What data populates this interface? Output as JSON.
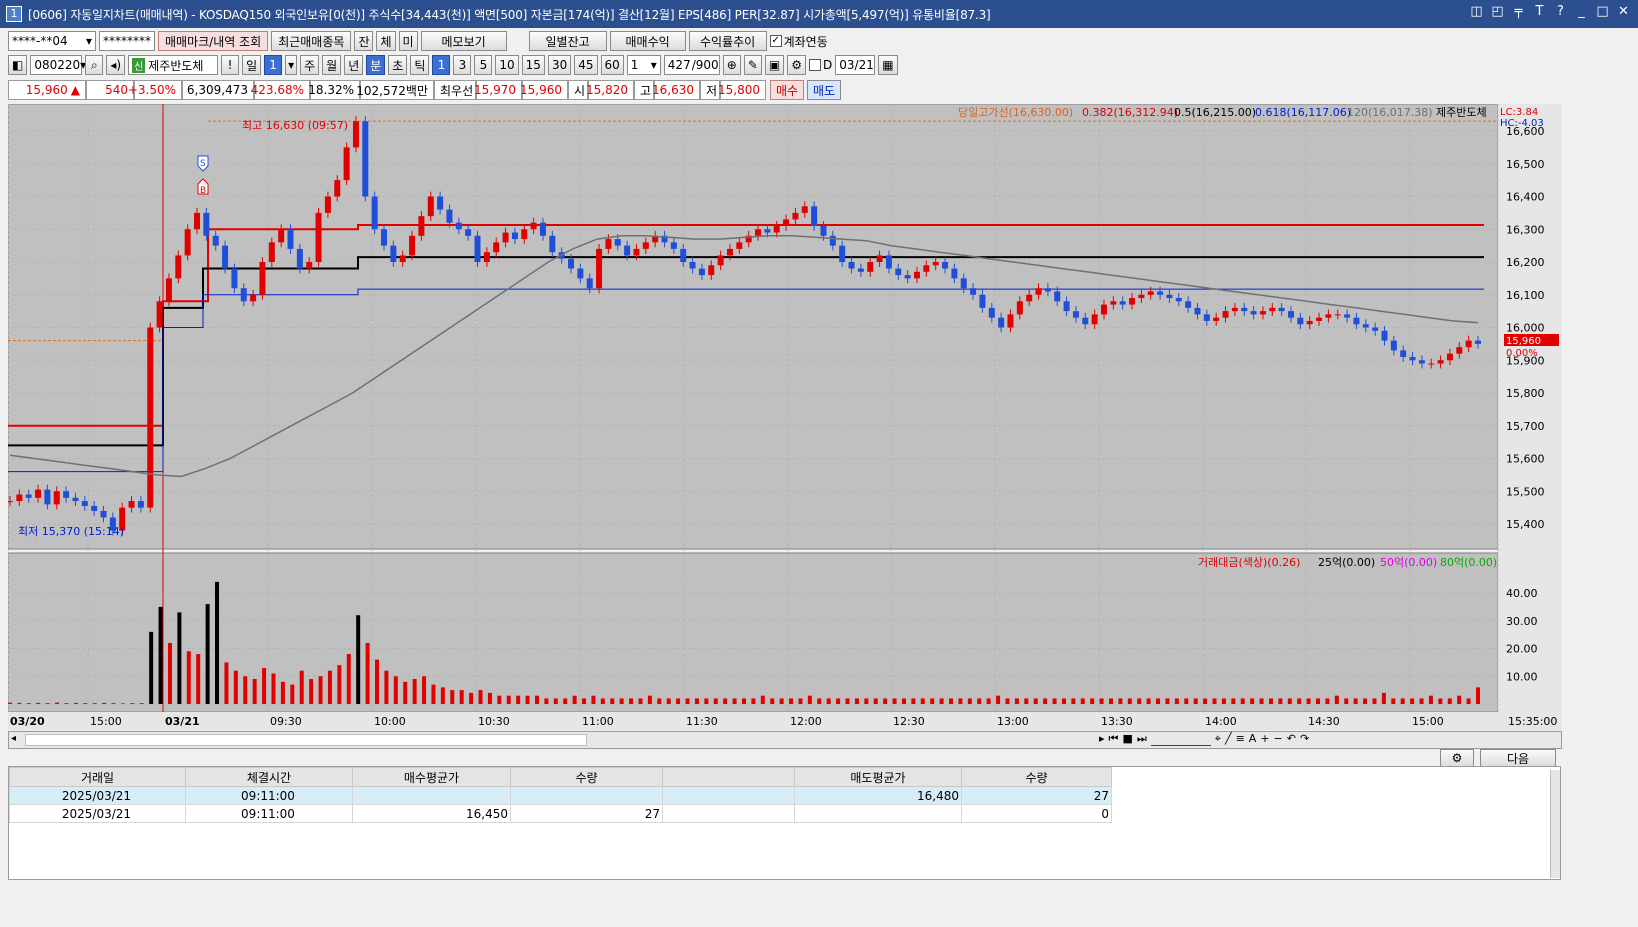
{
  "window": {
    "title": "[0606] 자동일지차트(매매내역) - KOSDAQ150 외국인보유[0(천)] 주식수[34,443(천)] 액면[500] 자본금[174(억)] 결산[12월] EPS[486] PER[32.87] 시가총액[5,497(억)] 유통비율[87.3]",
    "icon": "1",
    "controls": [
      "◫",
      "◰",
      "╤",
      "T",
      "?",
      "_",
      "□",
      "✕"
    ]
  },
  "toolbar1": {
    "account": "****-**04",
    "password": "********",
    "buttons": [
      "매매마크/내역 조회",
      "최근매매종목",
      "잔",
      "체",
      "미",
      "메모보기",
      "일별잔고",
      "매매수익",
      "수익률추이"
    ],
    "link_label": "계좌연동",
    "link_checked": true
  },
  "toolbar2": {
    "code": "080220",
    "stock_name": "제주반도체",
    "periods": [
      "일",
      "1",
      "주",
      "월",
      "년",
      "분",
      "초",
      "틱"
    ],
    "minutes": [
      "1",
      "3",
      "5",
      "10",
      "15",
      "30",
      "45",
      "60"
    ],
    "multiplier": "1",
    "count": "427",
    "count_total": "/900",
    "d_label": "D",
    "date": "03/21"
  },
  "quote": {
    "price": "15,960",
    "arrow": "▲",
    "change": "540",
    "rate": "+3.50%",
    "volume": "6,309,473",
    "vol_ratio": "423.68%",
    "turnover": "18.32%",
    "amount": "102,572백만",
    "best_label": "최우선",
    "best_ask": "15,970",
    "best_bid": "15,960",
    "open_label": "시",
    "open": "15,820",
    "high_label": "고",
    "high": "16,630",
    "low_label": "저",
    "low": "15,800",
    "buy": "매수",
    "sell": "매도"
  },
  "colors": {
    "up": "#e00000",
    "down": "#1f4fd8",
    "bg": "#c0c0c0",
    "title": "#2b4f8f"
  },
  "chart_data": {
    "type": "line",
    "legend": [
      "당일고가선(16,630.00)",
      "0.382(16,312.94)",
      "0.5(16,215.00)",
      "0.618(16,117.06)",
      "120(16,017.38)",
      "제주반도체"
    ],
    "price_axis": [
      "16,600",
      "16,500",
      "16,400",
      "16,300",
      "16,200",
      "16,100",
      "16,000",
      "15,900",
      "15,800",
      "15,700",
      "15,600",
      "15,500",
      "15,400"
    ],
    "lc": "LC:3.84",
    "hc": "HC:-4.03",
    "current_price": "15,960",
    "current_pct": "0.00%",
    "high_marker": "최고 16,630 (09:57)",
    "low_marker": "최저 15,370 (15:14)",
    "marks": [
      "S",
      "B"
    ],
    "levels": {
      "high": 16630,
      "fib382": 16312.94,
      "fib50": 16215,
      "fib618": 16117.06
    },
    "close_series": [
      15470,
      15490,
      15480,
      15505,
      15460,
      15500,
      15480,
      15470,
      15455,
      15440,
      15420,
      15380,
      15450,
      15470,
      15450,
      16000,
      16080,
      16150,
      16220,
      16300,
      16350,
      16280,
      16250,
      16180,
      16120,
      16080,
      16100,
      16200,
      16260,
      16300,
      16240,
      16180,
      16200,
      16350,
      16400,
      16450,
      16550,
      16630,
      16400,
      16300,
      16250,
      16200,
      16220,
      16280,
      16340,
      16400,
      16360,
      16320,
      16300,
      16280,
      16200,
      16230,
      16260,
      16290,
      16270,
      16300,
      16320,
      16280,
      16230,
      16210,
      16180,
      16150,
      16120,
      16240,
      16270,
      16250,
      16220,
      16240,
      16260,
      16280,
      16260,
      16240,
      16200,
      16180,
      16160,
      16190,
      16220,
      16240,
      16260,
      16280,
      16300,
      16290,
      16310,
      16330,
      16350,
      16370,
      16310,
      16280,
      16250,
      16200,
      16180,
      16170,
      16200,
      16220,
      16180,
      16160,
      16150,
      16170,
      16190,
      16200,
      16180,
      16150,
      16120,
      16100,
      16060,
      16030,
      16000,
      16040,
      16080,
      16100,
      16120,
      16110,
      16080,
      16050,
      16030,
      16010,
      16040,
      16070,
      16080,
      16070,
      16090,
      16100,
      16110,
      16100,
      16090,
      16080,
      16060,
      16040,
      16020,
      16030,
      16050,
      16060,
      16050,
      16040,
      16050,
      16060,
      16050,
      16030,
      16010,
      16020,
      16030,
      16040,
      16040,
      16030,
      16010,
      16000,
      15990,
      15960,
      15930,
      15910,
      15900,
      15890,
      15890,
      15900,
      15920,
      15940,
      15960,
      15950
    ],
    "ma120_series": [
      15610,
      15600,
      15590,
      15580,
      15570,
      15560,
      15550,
      15545,
      15570,
      15600,
      15640,
      15680,
      15720,
      15760,
      15800,
      15850,
      15900,
      15950,
      16000,
      16050,
      16100,
      16150,
      16200,
      16240,
      16270,
      16280,
      16280,
      16275,
      16270,
      16270,
      16275,
      16280,
      16280,
      16275,
      16270,
      16265,
      16250,
      16240,
      16230,
      16220,
      16210,
      16200,
      16190,
      16180,
      16170,
      16160,
      16150,
      16140,
      16130,
      16120,
      16110,
      16100,
      16090,
      16080,
      16070,
      16060,
      16050,
      16040,
      16030,
      16020,
      16015
    ],
    "time_labels": [
      "03/20",
      "15:00",
      "03/21",
      "09:30",
      "10:00",
      "10:30",
      "11:00",
      "11:30",
      "12:00",
      "12:30",
      "13:00",
      "13:30",
      "14:00",
      "14:30",
      "15:00",
      "15:35:00"
    ],
    "volume_legend": [
      "거래대금(색상)(0.26)",
      "25억(0.00)",
      "50억(0.00)",
      "80억(0.00)"
    ],
    "volume_axis": [
      "40.00",
      "30.00",
      "20.00",
      "10.00"
    ],
    "volume_series": [
      0.5,
      0.4,
      0.3,
      0.4,
      0.3,
      0.5,
      0.3,
      0.4,
      0.3,
      0.3,
      0.4,
      0.3,
      0.2,
      0.3,
      0.3,
      26,
      35,
      22,
      33,
      19,
      18,
      36,
      44,
      15,
      12,
      10,
      9,
      13,
      11,
      8,
      7,
      12,
      9,
      10,
      12,
      14,
      18,
      32,
      22,
      16,
      12,
      10,
      8,
      9,
      10,
      7,
      6,
      5,
      5,
      4,
      5,
      4,
      3,
      3,
      3,
      3,
      3,
      2,
      2,
      2,
      3,
      2,
      3,
      2,
      2,
      2,
      2,
      2,
      3,
      2,
      2,
      2,
      2,
      2,
      2,
      2,
      2,
      2,
      2,
      2,
      3,
      2,
      2,
      2,
      2,
      3,
      2,
      2,
      2,
      2,
      2,
      2,
      2,
      2,
      2,
      2,
      2,
      2,
      2,
      2,
      2,
      2,
      2,
      2,
      2,
      3,
      2,
      2,
      2,
      2,
      2,
      2,
      2,
      2,
      2,
      2,
      2,
      2,
      2,
      2,
      2,
      2,
      2,
      2,
      2,
      2,
      2,
      2,
      2,
      2,
      2,
      2,
      2,
      2,
      2,
      2,
      2,
      2,
      2,
      2,
      2,
      3,
      2,
      2,
      2,
      2,
      4,
      2,
      2,
      2,
      2,
      3,
      2,
      2,
      3,
      2,
      6
    ]
  },
  "bottom": {
    "settings_icon": "gear-icon",
    "next": "다음"
  },
  "table": {
    "headers": [
      "거래일",
      "체결시간",
      "매수평균가",
      "수량",
      "",
      "매도평균가",
      "수량"
    ],
    "rows": [
      [
        "2025/03/21",
        "09:11:00",
        "",
        "",
        "",
        "16,480",
        "27"
      ],
      [
        "2025/03/21",
        "09:11:00",
        "16,450",
        "27",
        "",
        "",
        "0"
      ]
    ]
  }
}
